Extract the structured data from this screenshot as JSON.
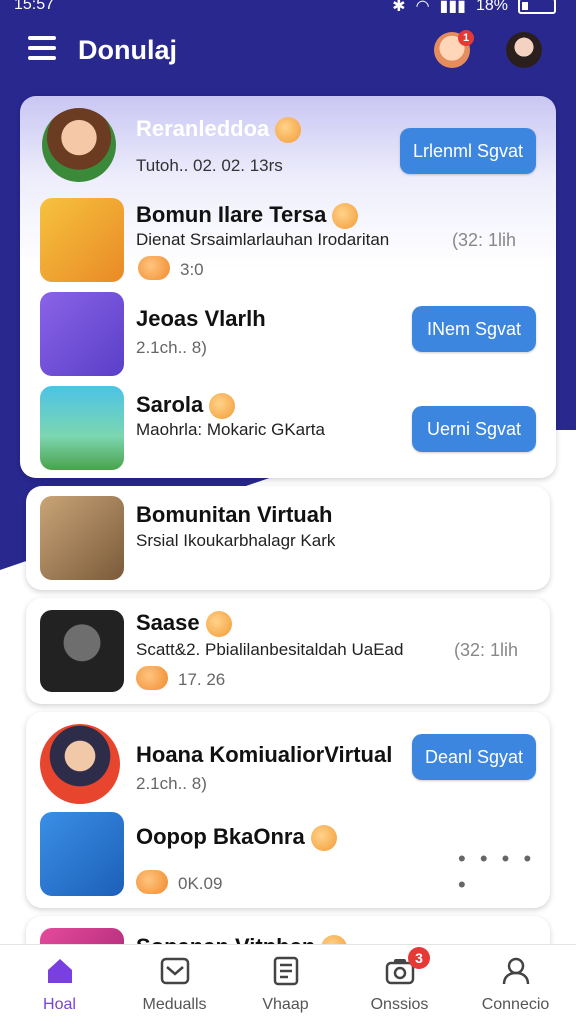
{
  "status_bar": {
    "time": "15:57",
    "battery": "18%"
  },
  "header": {
    "title": "Donulaj",
    "notification_count": "1"
  },
  "featured_card": {
    "items": [
      {
        "title": "Reranleddoa",
        "subtitle": "Tutoh.. 02. 02. 13rs",
        "button": "Lrlenml Sgvat"
      },
      {
        "title": "Bomun Ilare Tersa",
        "subtitle": "Dienat Srsaimlarlauhan Irodaritan",
        "time": "(32: 1lih",
        "count": "3:0"
      },
      {
        "title": "Jeoas Vlarlh",
        "meta": "2.1ch.. 8)",
        "button": "INem Sgvat"
      },
      {
        "title": "Sarola",
        "subtitle": "Maohrla: Mokaric GKarta",
        "button": "Uerni Sgvat"
      }
    ]
  },
  "cards": [
    {
      "title": "Bomunitan Virtuah",
      "subtitle": "Srsial Ikoukarbhalagr Kark"
    },
    {
      "title": "Saase",
      "subtitle": "Scatt&2. Pbialilanbesitaldah UaEad",
      "time": "(32: 1lih",
      "count": "17. 26"
    }
  ],
  "group_card": {
    "items": [
      {
        "title": "Hoana KomiualiorVirtual",
        "meta": "2.1ch.. 8)",
        "button": "Deanl Sgyat"
      },
      {
        "title": "Oopop BkaOnra",
        "count": "0K.09",
        "more": "• • • • •"
      }
    ]
  },
  "partial_card": {
    "title": "Sopanan Vitphen"
  },
  "bottom_nav": [
    {
      "label": "Hoal"
    },
    {
      "label": "Medualls"
    },
    {
      "label": "Vhaap"
    },
    {
      "label": "Onssios",
      "badge": "3"
    },
    {
      "label": "Connecio"
    }
  ],
  "colors": {
    "primary": "#28288f",
    "button": "#3d86e0",
    "active": "#7a3fe0",
    "badge": "#e53935"
  }
}
